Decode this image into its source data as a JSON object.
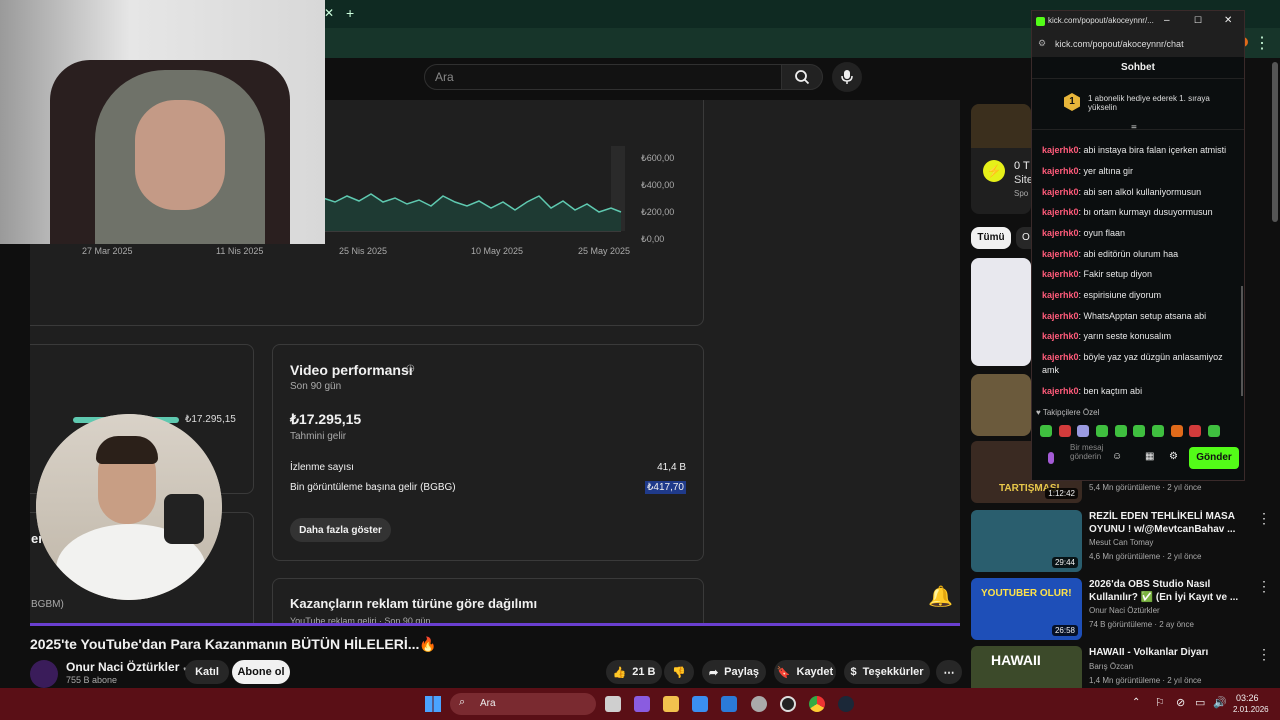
{
  "youtube": {
    "search_placeholder": "Ara",
    "chart": {
      "y_ticks": [
        "₺600,00",
        "₺400,00",
        "₺200,00",
        "₺0,00"
      ],
      "x_ticks": [
        "27 Mar 2025",
        "11 Nis 2025",
        "25 Nis 2025",
        "10 May 2025",
        "25 May 2025"
      ]
    },
    "left_card": {
      "bar_value": "₺17.295,15",
      "partial_text": "er",
      "partial_text2": "BGBM)"
    },
    "video_performance": {
      "title": "Video performansı",
      "subtitle": "Son 90 gün",
      "revenue": "₺17.295,15",
      "revenue_label": "Tahmini gelir",
      "views_label": "İzlenme sayısı",
      "views_value": "41,4 B",
      "rpm_label": "Bin görüntüleme başına gelir (BGBG)",
      "rpm_value": "₺417,70",
      "more_button": "Daha fazla göster"
    },
    "ads_card": {
      "title": "Kazançların reklam türüne göre dağılımı",
      "subtitle": "YouTube reklam geliri · Son 90 gün"
    },
    "video": {
      "title": "2025'te YouTube'dan Para Kazanmanın BÜTÜN HİLELERİ...🔥",
      "channel": "Onur Naci Öztürkler",
      "subscribers": "755 B abone",
      "join": "Katıl",
      "subscribe": "Abone ol",
      "likes": "21 B",
      "share": "Paylaş",
      "save": "Kaydet",
      "thanks": "Teşekkürler"
    },
    "sidebar": {
      "ad_text1": "0 T",
      "ad_text2": "Site",
      "ad_text3": "Spo",
      "chip_all": "Tümü",
      "chip_other": "O",
      "recs": [
        {
          "title": "",
          "channel": "",
          "meta": "5,4 Mn görüntüleme · 2 yıl önce",
          "duration": "1:12:42",
          "thumb_text": "TARTIŞMASI"
        },
        {
          "title": "REZİL EDEN TEHLİKELİ MASA OYUNU ! w/@MevtcanBahav ...",
          "channel": "Mesut Can Tomay",
          "meta": "4,6 Mn görüntüleme · 2 yıl önce",
          "duration": "29:44"
        },
        {
          "title": "2026'da OBS Studio Nasıl Kullanılır? ✅ (En İyi Kayıt ve ...",
          "channel": "Onur Naci Öztürkler",
          "meta": "74 B görüntüleme · 2 ay önce",
          "duration": "26:58",
          "thumb_text": "YOUTUBER OLUR!"
        },
        {
          "title": "HAWAII - Volkanlar Diyarı",
          "channel": "Barış Özcan",
          "meta": "1,4 Mn görüntüleme · 2 yıl önce",
          "duration": "",
          "thumb_text": "HAWAII"
        }
      ]
    }
  },
  "kick": {
    "window_title": "kick.com/popout/akoceynnr/...",
    "url": "kick.com/popout/akoceynnr/chat",
    "chat_header": "Sohbet",
    "gift_badge": "1",
    "gift_text": "1 abonelik hediye ederek 1. sıraya yükselin",
    "messages": [
      {
        "user": "kajerhk0",
        "text": ": abi instaya bira falan içerken atmisti"
      },
      {
        "user": "kajerhk0",
        "text": ": yer altına gir"
      },
      {
        "user": "kajerhk0",
        "text": ": abi sen alkol kullaniyormusun"
      },
      {
        "user": "kajerhk0",
        "text": ": bı ortam kurmayı dusuyormusun"
      },
      {
        "user": "kajerhk0",
        "text": ": oyun flaan"
      },
      {
        "user": "kajerhk0",
        "text": ": abi editörün olurum haa"
      },
      {
        "user": "kajerhk0",
        "text": ": Fakir setup diyon"
      },
      {
        "user": "kajerhk0",
        "text": ": espirisiune diyorum"
      },
      {
        "user": "kajerhk0",
        "text": ": WhatsApptan setup atsana abi"
      },
      {
        "user": "kajerhk0",
        "text": ": yarın seste konusalım"
      },
      {
        "user": "kajerhk0",
        "text": ": böyle yaz yaz düzgün anlasamiyoz amk"
      },
      {
        "user": "kajerhk0",
        "text": ": ben kaçtım abi"
      }
    ],
    "followers_only": "Takipçilere Özel",
    "input_placeholder": "Bir mesaj gönderin",
    "send_button": "Gönder"
  },
  "taskbar": {
    "search": "Ara",
    "time": "03:26",
    "date": "2.01.2026"
  },
  "colors": {
    "kick_green": "#53fc18",
    "taskbar": "#5a0f16",
    "chart_line": "#5fc9b0",
    "highlight": "#1f3a8a"
  }
}
